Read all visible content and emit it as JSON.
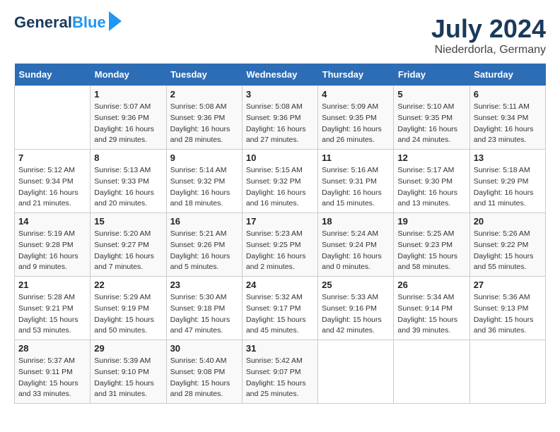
{
  "header": {
    "logo_line1": "General",
    "logo_line2": "Blue",
    "month_year": "July 2024",
    "location": "Niederdorla, Germany"
  },
  "weekdays": [
    "Sunday",
    "Monday",
    "Tuesday",
    "Wednesday",
    "Thursday",
    "Friday",
    "Saturday"
  ],
  "weeks": [
    [
      {
        "day": "",
        "sunrise": "",
        "sunset": "",
        "daylight": ""
      },
      {
        "day": "1",
        "sunrise": "Sunrise: 5:07 AM",
        "sunset": "Sunset: 9:36 PM",
        "daylight": "Daylight: 16 hours and 29 minutes."
      },
      {
        "day": "2",
        "sunrise": "Sunrise: 5:08 AM",
        "sunset": "Sunset: 9:36 PM",
        "daylight": "Daylight: 16 hours and 28 minutes."
      },
      {
        "day": "3",
        "sunrise": "Sunrise: 5:08 AM",
        "sunset": "Sunset: 9:36 PM",
        "daylight": "Daylight: 16 hours and 27 minutes."
      },
      {
        "day": "4",
        "sunrise": "Sunrise: 5:09 AM",
        "sunset": "Sunset: 9:35 PM",
        "daylight": "Daylight: 16 hours and 26 minutes."
      },
      {
        "day": "5",
        "sunrise": "Sunrise: 5:10 AM",
        "sunset": "Sunset: 9:35 PM",
        "daylight": "Daylight: 16 hours and 24 minutes."
      },
      {
        "day": "6",
        "sunrise": "Sunrise: 5:11 AM",
        "sunset": "Sunset: 9:34 PM",
        "daylight": "Daylight: 16 hours and 23 minutes."
      }
    ],
    [
      {
        "day": "7",
        "sunrise": "Sunrise: 5:12 AM",
        "sunset": "Sunset: 9:34 PM",
        "daylight": "Daylight: 16 hours and 21 minutes."
      },
      {
        "day": "8",
        "sunrise": "Sunrise: 5:13 AM",
        "sunset": "Sunset: 9:33 PM",
        "daylight": "Daylight: 16 hours and 20 minutes."
      },
      {
        "day": "9",
        "sunrise": "Sunrise: 5:14 AM",
        "sunset": "Sunset: 9:32 PM",
        "daylight": "Daylight: 16 hours and 18 minutes."
      },
      {
        "day": "10",
        "sunrise": "Sunrise: 5:15 AM",
        "sunset": "Sunset: 9:32 PM",
        "daylight": "Daylight: 16 hours and 16 minutes."
      },
      {
        "day": "11",
        "sunrise": "Sunrise: 5:16 AM",
        "sunset": "Sunset: 9:31 PM",
        "daylight": "Daylight: 16 hours and 15 minutes."
      },
      {
        "day": "12",
        "sunrise": "Sunrise: 5:17 AM",
        "sunset": "Sunset: 9:30 PM",
        "daylight": "Daylight: 16 hours and 13 minutes."
      },
      {
        "day": "13",
        "sunrise": "Sunrise: 5:18 AM",
        "sunset": "Sunset: 9:29 PM",
        "daylight": "Daylight: 16 hours and 11 minutes."
      }
    ],
    [
      {
        "day": "14",
        "sunrise": "Sunrise: 5:19 AM",
        "sunset": "Sunset: 9:28 PM",
        "daylight": "Daylight: 16 hours and 9 minutes."
      },
      {
        "day": "15",
        "sunrise": "Sunrise: 5:20 AM",
        "sunset": "Sunset: 9:27 PM",
        "daylight": "Daylight: 16 hours and 7 minutes."
      },
      {
        "day": "16",
        "sunrise": "Sunrise: 5:21 AM",
        "sunset": "Sunset: 9:26 PM",
        "daylight": "Daylight: 16 hours and 5 minutes."
      },
      {
        "day": "17",
        "sunrise": "Sunrise: 5:23 AM",
        "sunset": "Sunset: 9:25 PM",
        "daylight": "Daylight: 16 hours and 2 minutes."
      },
      {
        "day": "18",
        "sunrise": "Sunrise: 5:24 AM",
        "sunset": "Sunset: 9:24 PM",
        "daylight": "Daylight: 16 hours and 0 minutes."
      },
      {
        "day": "19",
        "sunrise": "Sunrise: 5:25 AM",
        "sunset": "Sunset: 9:23 PM",
        "daylight": "Daylight: 15 hours and 58 minutes."
      },
      {
        "day": "20",
        "sunrise": "Sunrise: 5:26 AM",
        "sunset": "Sunset: 9:22 PM",
        "daylight": "Daylight: 15 hours and 55 minutes."
      }
    ],
    [
      {
        "day": "21",
        "sunrise": "Sunrise: 5:28 AM",
        "sunset": "Sunset: 9:21 PM",
        "daylight": "Daylight: 15 hours and 53 minutes."
      },
      {
        "day": "22",
        "sunrise": "Sunrise: 5:29 AM",
        "sunset": "Sunset: 9:19 PM",
        "daylight": "Daylight: 15 hours and 50 minutes."
      },
      {
        "day": "23",
        "sunrise": "Sunrise: 5:30 AM",
        "sunset": "Sunset: 9:18 PM",
        "daylight": "Daylight: 15 hours and 47 minutes."
      },
      {
        "day": "24",
        "sunrise": "Sunrise: 5:32 AM",
        "sunset": "Sunset: 9:17 PM",
        "daylight": "Daylight: 15 hours and 45 minutes."
      },
      {
        "day": "25",
        "sunrise": "Sunrise: 5:33 AM",
        "sunset": "Sunset: 9:16 PM",
        "daylight": "Daylight: 15 hours and 42 minutes."
      },
      {
        "day": "26",
        "sunrise": "Sunrise: 5:34 AM",
        "sunset": "Sunset: 9:14 PM",
        "daylight": "Daylight: 15 hours and 39 minutes."
      },
      {
        "day": "27",
        "sunrise": "Sunrise: 5:36 AM",
        "sunset": "Sunset: 9:13 PM",
        "daylight": "Daylight: 15 hours and 36 minutes."
      }
    ],
    [
      {
        "day": "28",
        "sunrise": "Sunrise: 5:37 AM",
        "sunset": "Sunset: 9:11 PM",
        "daylight": "Daylight: 15 hours and 33 minutes."
      },
      {
        "day": "29",
        "sunrise": "Sunrise: 5:39 AM",
        "sunset": "Sunset: 9:10 PM",
        "daylight": "Daylight: 15 hours and 31 minutes."
      },
      {
        "day": "30",
        "sunrise": "Sunrise: 5:40 AM",
        "sunset": "Sunset: 9:08 PM",
        "daylight": "Daylight: 15 hours and 28 minutes."
      },
      {
        "day": "31",
        "sunrise": "Sunrise: 5:42 AM",
        "sunset": "Sunset: 9:07 PM",
        "daylight": "Daylight: 15 hours and 25 minutes."
      },
      {
        "day": "",
        "sunrise": "",
        "sunset": "",
        "daylight": ""
      },
      {
        "day": "",
        "sunrise": "",
        "sunset": "",
        "daylight": ""
      },
      {
        "day": "",
        "sunrise": "",
        "sunset": "",
        "daylight": ""
      }
    ]
  ]
}
